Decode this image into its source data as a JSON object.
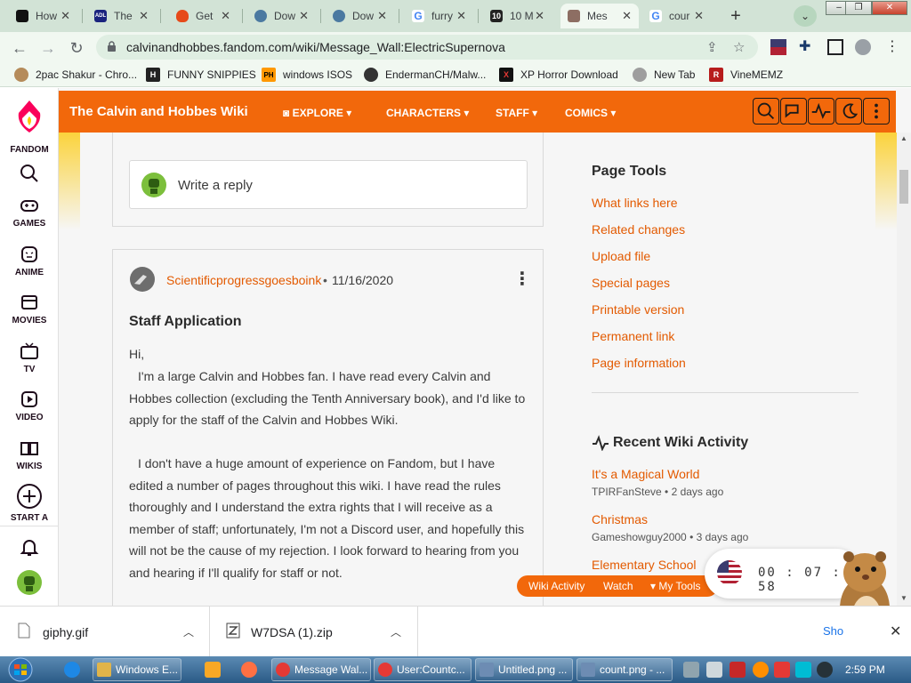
{
  "tabs": [
    {
      "title": "How",
      "favicon_color": "#111111",
      "favicon_label": ""
    },
    {
      "title": "The",
      "favicon_color": "#1a237e",
      "favicon_label": "ADL"
    },
    {
      "title": "Get",
      "favicon_color": "#e64a19",
      "favicon_label": ""
    },
    {
      "title": "Dow",
      "favicon_color": "#4b79a1",
      "favicon_label": ""
    },
    {
      "title": "Dow",
      "favicon_color": "#4b79a1",
      "favicon_label": ""
    },
    {
      "title": "furry",
      "favicon_color": "#4285f4",
      "favicon_label": "G"
    },
    {
      "title": "10 M",
      "favicon_color": "#222222",
      "favicon_label": "10"
    },
    {
      "title": "Mes",
      "favicon_color": "#8d6e63",
      "favicon_label": "",
      "active": true
    },
    {
      "title": "cour",
      "favicon_color": "#4285f4",
      "favicon_label": "G"
    }
  ],
  "toolbar": {
    "url": "calvinandhobbes.fandom.com/wiki/Message_Wall:ElectricSupernova"
  },
  "bookmarks": [
    {
      "label": "2pac Shakur - Chro...",
      "color": "#b58b5a",
      "glyph": ""
    },
    {
      "label": "FUNNY SNIPPIES",
      "color": "#222222",
      "glyph": "H"
    },
    {
      "label": "windows ISOS",
      "color": "#ff9800",
      "glyph": "PH"
    },
    {
      "label": "EndermanCH/Malw...",
      "color": "#333333",
      "glyph": ""
    },
    {
      "label": "XP Horror Download",
      "color": "#c62828",
      "glyph": "X"
    },
    {
      "label": "New Tab",
      "color": "#9e9e9e",
      "glyph": ""
    },
    {
      "label": "VineMEMZ",
      "color": "#b71c1c",
      "glyph": "R"
    }
  ],
  "fandom_rail": {
    "logo_label": "FANDOM",
    "items": [
      {
        "label": "GAMES",
        "icon": "gamepad-icon"
      },
      {
        "label": "ANIME",
        "icon": "anime-icon"
      },
      {
        "label": "MOVIES",
        "icon": "movie-icon"
      },
      {
        "label": "TV",
        "icon": "tv-icon"
      },
      {
        "label": "VIDEO",
        "icon": "video-icon"
      },
      {
        "label": "WIKIS",
        "icon": "book-icon"
      },
      {
        "label": "START A",
        "icon": "plus-circle-icon"
      }
    ]
  },
  "wiki": {
    "title": "The Calvin and Hobbes Wiki",
    "nav": [
      "EXPLORE",
      "CHARACTERS",
      "STAFF",
      "COMICS"
    ],
    "accent": "#f2680b"
  },
  "reply": {
    "placeholder": "Write a reply"
  },
  "message": {
    "author": "Scientificprogressgoesboink",
    "date": "11/16/2020",
    "title": "Staff Application",
    "greeting": "Hi,",
    "paragraph1": "I'm a large Calvin and Hobbes fan. I have read every Calvin and Hobbes collection (excluding the Tenth Anniversary book), and I'd like to apply for the staff of the Calvin and Hobbes Wiki.",
    "paragraph2": "I don't have a huge amount of experience on Fandom, but I have edited a number of pages throughout this wiki. I have read the rules thoroughly and I understand the extra rights that I will receive as a member of staff; unfortunately, I'm not a Discord user, and hopefully this will not be the cause of my rejection. I look forward to hearing from you and hearing if I'll qualify for staff or not."
  },
  "page_tools": {
    "title": "Page Tools",
    "links": [
      "What links here",
      "Related changes",
      "Upload file",
      "Special pages",
      "Printable version",
      "Permanent link",
      "Page information"
    ]
  },
  "recent_activity": {
    "title": "Recent Wiki Activity",
    "items": [
      {
        "title": "It's a Magical World",
        "meta": "TPIRFanSteve • 2 days ago"
      },
      {
        "title": "Christmas",
        "meta": "Gameshowguy2000 • 3 days ago"
      },
      {
        "title": "Elementary School",
        "meta": ""
      }
    ]
  },
  "action_bar": {
    "items": [
      "Wiki Activity",
      "Watch",
      "My Tools"
    ]
  },
  "timer": {
    "display": "00 : 07 : 58"
  },
  "downloads": [
    {
      "name": "giphy.gif"
    },
    {
      "name": "W7DSA (1).zip"
    }
  ],
  "downloads_show_all": "Sho",
  "taskbar": {
    "buttons": [
      {
        "label": "Windows E...",
        "color": "#e0b44a"
      },
      {
        "label": "Message Wal...",
        "color": "#e53935"
      },
      {
        "label": "User:Countc...",
        "color": "#e53935"
      },
      {
        "label": "Untitled.png ...",
        "color": "#6d8cb3"
      },
      {
        "label": "count.png - ...",
        "color": "#6d8cb3"
      }
    ],
    "clock": "2:59 PM"
  }
}
